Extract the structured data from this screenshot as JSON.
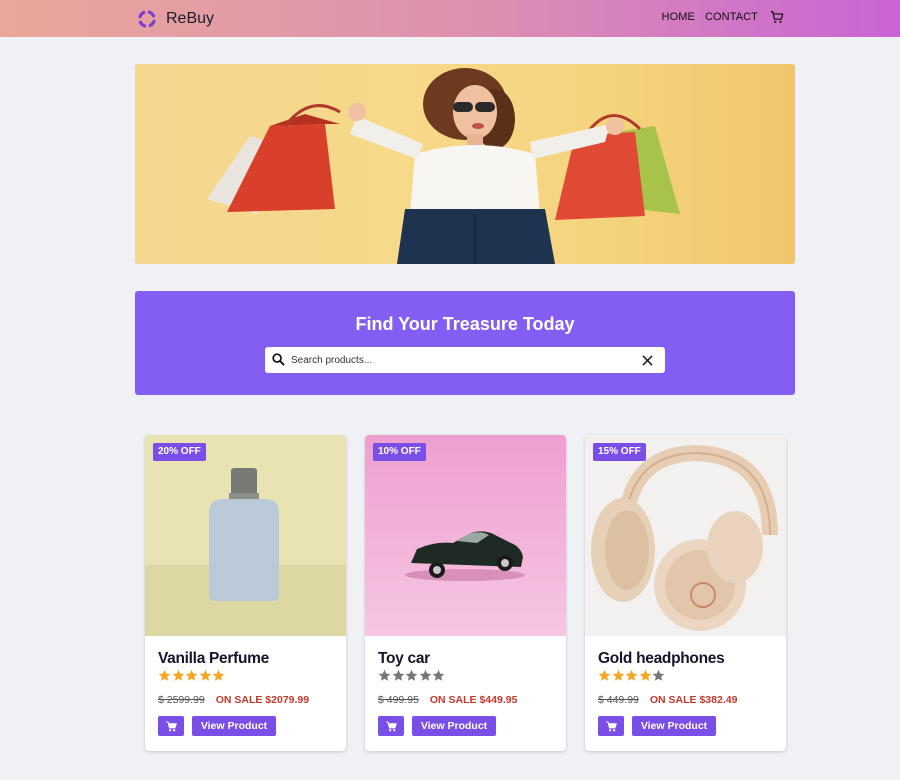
{
  "nav": {
    "brand": "ReBuy",
    "links": [
      "HOME",
      "CONTACT"
    ],
    "cart_icon": "cart-icon"
  },
  "banner": {
    "title": "Find Your Treasure Today",
    "search_placeholder": "Search products...",
    "search_value": ""
  },
  "colors": {
    "primary": "#7a4fe8",
    "banner": "#845ef2",
    "sale": "#c0392b",
    "star_filled": "#f5a623",
    "star_empty": "#777777"
  },
  "products": [
    {
      "badge": "20% OFF",
      "title": "Vanilla Perfume",
      "rating": 5,
      "old_price": "$ 2599.99",
      "sale_price": "ON SALE $2079.99",
      "button": "View Product"
    },
    {
      "badge": "10% OFF",
      "title": "Toy car",
      "rating": 0,
      "old_price": "$ 499.95",
      "sale_price": "ON SALE $449.95",
      "button": "View Product"
    },
    {
      "badge": "15% OFF",
      "title": "Gold headphones",
      "rating": 4,
      "old_price": "$ 449.99",
      "sale_price": "ON SALE $382.49",
      "button": "View Product"
    }
  ]
}
